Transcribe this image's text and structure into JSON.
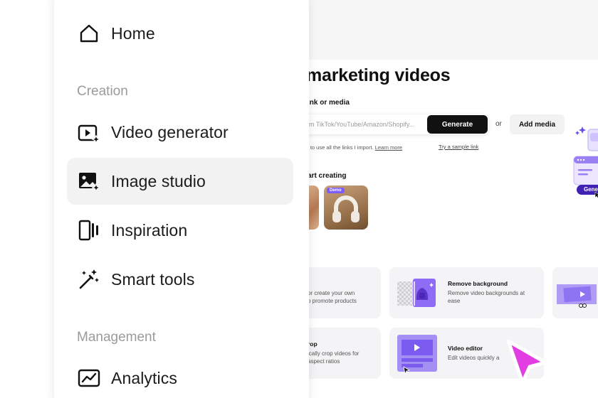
{
  "background": {
    "page_title": "marketing videos",
    "link_section_label": "ink or media",
    "link_input_placeholder": "m TikTok/YouTube/Amazon/Shopify...",
    "generate_label": "Generate",
    "or_label": "or",
    "add_media_label": "Add media",
    "hint_text": "s to use all the links I import.",
    "learn_more_label": "Learn more",
    "sample_link_label": "Try a sample link",
    "start_section_label": "art creating",
    "demo_badge": "Demo",
    "side_generate_label": "Gene",
    "tools": {
      "card1_desc_1": "or create your own",
      "card1_desc_2": "o promote products",
      "remove_bg_title": "Remove background",
      "remove_bg_desc_1": "Remove video backgrounds at",
      "remove_bg_desc_2": "ease",
      "crop_title": "rop",
      "crop_desc_1": "ically crop videos for",
      "crop_desc_2": "aspect ratios",
      "video_editor_title": "Video editor",
      "video_editor_desc": "Edit videos quickly a"
    },
    "colors": {
      "accent_purple": "#7c5cff",
      "cursor_pink": "#e23de2"
    }
  },
  "sidebar": {
    "home_label": "Home",
    "creation_group": "Creation",
    "video_generator_label": "Video generator",
    "image_studio_label": "Image studio",
    "inspiration_label": "Inspiration",
    "smart_tools_label": "Smart tools",
    "management_group": "Management",
    "analytics_label": "Analytics",
    "active_item": "Image studio",
    "icons": [
      "home-icon",
      "video-sparkle-icon",
      "image-sparkle-icon",
      "inspiration-icon",
      "magic-wand-icon",
      "analytics-icon"
    ]
  }
}
